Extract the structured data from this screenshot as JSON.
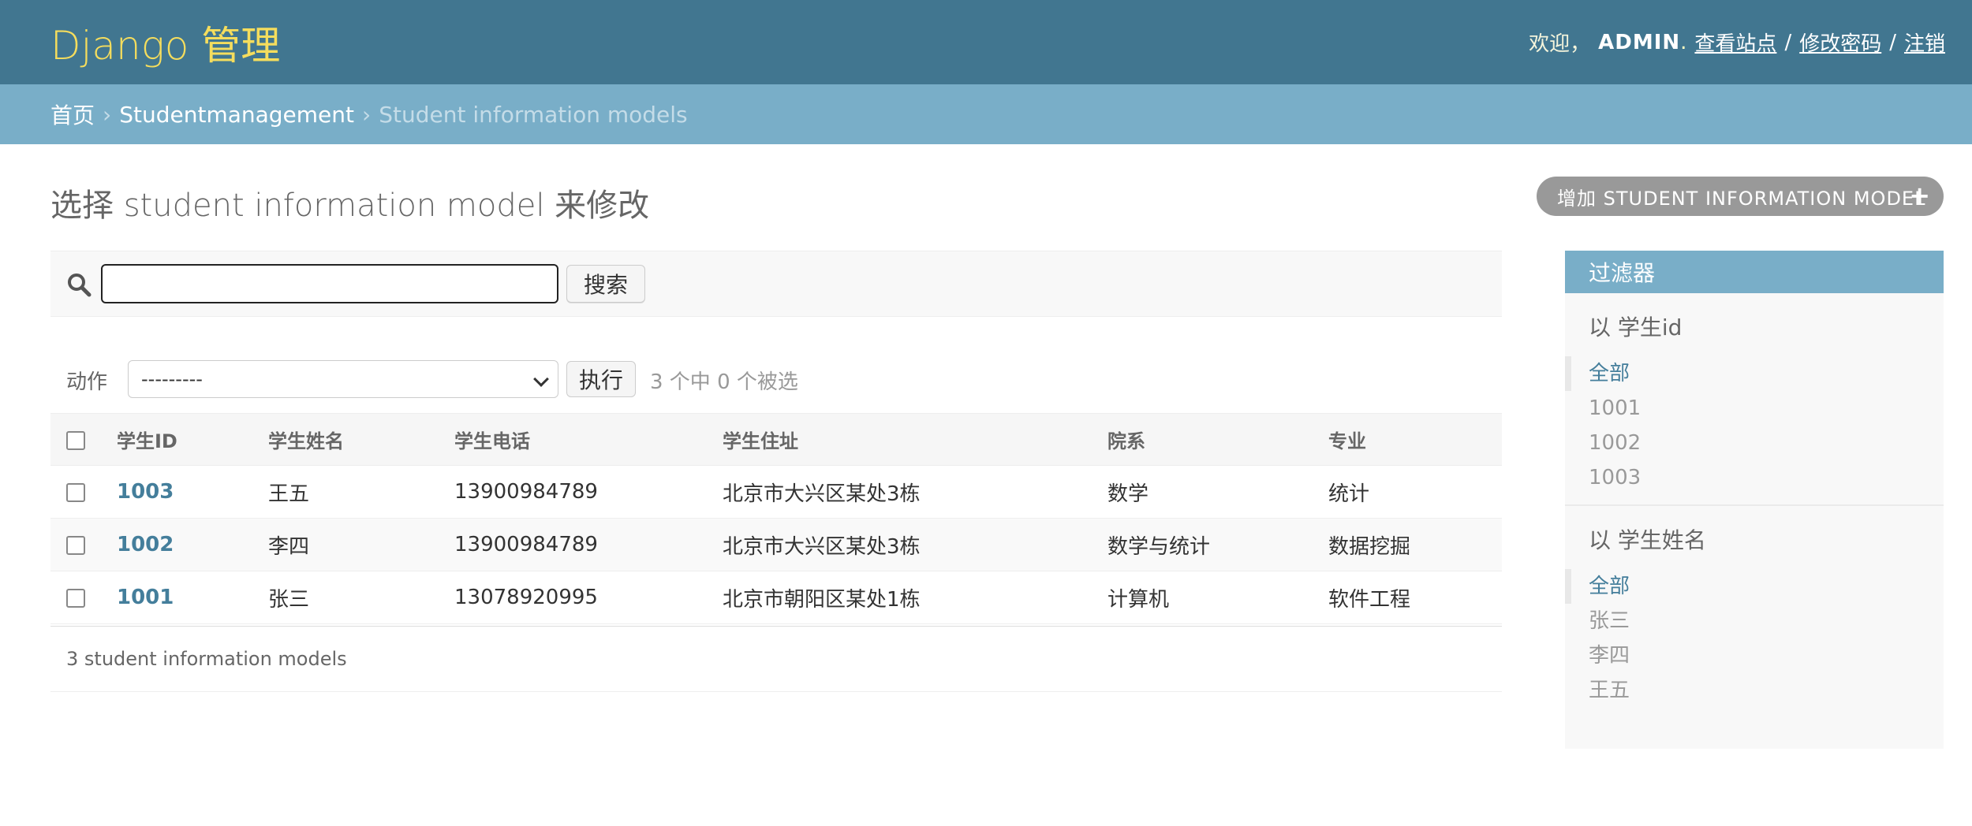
{
  "header": {
    "site_name": "Django 管理",
    "welcome": "欢迎，",
    "username": "ADMIN",
    "username_suffix": ".",
    "view_site": "查看站点",
    "change_password": "修改密码",
    "logout": "注销",
    "separator": "/"
  },
  "breadcrumbs": {
    "home": "首页",
    "app": "Studentmanagement",
    "current": "Student information models",
    "separator": "›"
  },
  "page": {
    "title": "选择 student information model 来修改",
    "add_button": "增加 STUDENT INFORMATION MODEL",
    "add_icon": "+"
  },
  "search": {
    "value": "",
    "button": "搜索"
  },
  "actions": {
    "label": "动作",
    "selected_option": "---------",
    "run_button": "执行",
    "counter": "3 个中 0 个被选"
  },
  "table": {
    "columns": [
      "学生ID",
      "学生姓名",
      "学生电话",
      "学生住址",
      "院系",
      "专业"
    ],
    "rows": [
      {
        "id": "1003",
        "name": "王五",
        "phone": "13900984789",
        "address": "北京市大兴区某处3栋",
        "dept": "数学",
        "major": "统计"
      },
      {
        "id": "1002",
        "name": "李四",
        "phone": "13900984789",
        "address": "北京市大兴区某处3栋",
        "dept": "数学与统计",
        "major": "数据挖掘"
      },
      {
        "id": "1001",
        "name": "张三",
        "phone": "13078920995",
        "address": "北京市朝阳区某处1栋",
        "dept": "计算机",
        "major": "软件工程"
      }
    ],
    "count_text": "3 student information models"
  },
  "filter": {
    "title": "过滤器",
    "groups": [
      {
        "heading": "以 学生id",
        "items": [
          "全部",
          "1001",
          "1002",
          "1003"
        ]
      },
      {
        "heading": "以 学生姓名",
        "items": [
          "全部",
          "张三",
          "李四",
          "王五"
        ]
      }
    ]
  },
  "colors": {
    "header_bg": "#417690",
    "breadcrumb_bg": "#79aec8",
    "site_name": "#f5dd5d",
    "link": "#447e9b"
  }
}
